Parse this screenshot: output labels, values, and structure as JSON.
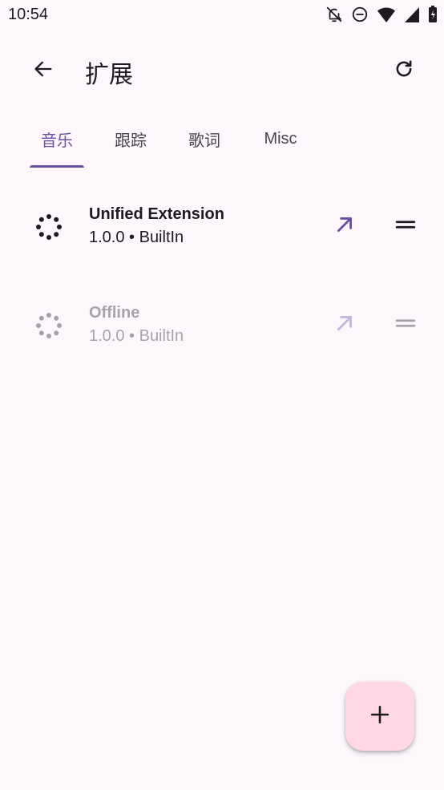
{
  "status_bar": {
    "time": "10:54",
    "icons": [
      "bell-off-icon",
      "do-not-disturb-icon",
      "wifi-icon",
      "signal-icon",
      "battery-icon"
    ]
  },
  "app_bar": {
    "title": "扩展",
    "back_icon": "arrow-back-icon",
    "refresh_icon": "refresh-icon"
  },
  "tabs": [
    {
      "label": "音乐",
      "active": true
    },
    {
      "label": "跟踪",
      "active": false
    },
    {
      "label": "歌词",
      "active": false
    },
    {
      "label": "Misc",
      "active": false
    }
  ],
  "extensions": [
    {
      "name": "Unified Extension",
      "meta": "1.0.0 • BuiltIn",
      "enabled": true,
      "icon": "loader-icon"
    },
    {
      "name": "Offline",
      "meta": "1.0.0 • BuiltIn",
      "enabled": false,
      "icon": "loader-icon"
    }
  ],
  "fab": {
    "icon": "plus-icon"
  },
  "colors": {
    "background": "#fdf7fc",
    "primary": "#6750a4",
    "on_surface": "#1d1b20",
    "fab_container": "#ffd8e4"
  }
}
